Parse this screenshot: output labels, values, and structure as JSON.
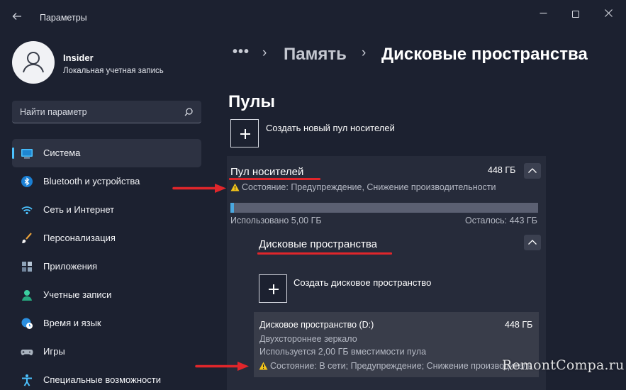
{
  "window": {
    "title": "Параметры"
  },
  "user": {
    "name": "Insider",
    "account_type": "Локальная учетная запись"
  },
  "search": {
    "placeholder": "Найти параметр"
  },
  "sidebar": {
    "items": [
      {
        "label": "Система",
        "icon": "system-icon",
        "active": true
      },
      {
        "label": "Bluetooth и устройства",
        "icon": "bluetooth-icon"
      },
      {
        "label": "Сеть и Интернет",
        "icon": "wifi-icon"
      },
      {
        "label": "Персонализация",
        "icon": "brush-icon"
      },
      {
        "label": "Приложения",
        "icon": "apps-icon"
      },
      {
        "label": "Учетные записи",
        "icon": "account-icon"
      },
      {
        "label": "Время и язык",
        "icon": "globe-clock-icon"
      },
      {
        "label": "Игры",
        "icon": "gamepad-icon"
      },
      {
        "label": "Специальные возможности",
        "icon": "accessibility-icon"
      }
    ]
  },
  "breadcrumb": {
    "more": "•••",
    "parent": "Память",
    "current": "Дисковые пространства"
  },
  "pools": {
    "section_title": "Пулы",
    "create_label": "Создать новый пул носителей",
    "pool": {
      "name": "Пул носителей",
      "size": "448 ГБ",
      "status": "Состояние: Предупреждение, Снижение производительности",
      "used_fraction": 0.011,
      "used_label": "Использовано 5,00 ГБ",
      "free_label": "Осталось: 443 ГБ"
    }
  },
  "spaces": {
    "title": "Дисковые пространства",
    "create_label": "Создать дисковое пространство",
    "space": {
      "name": "Дисковое пространство (D:)",
      "size": "448 ГБ",
      "type": "Двухстороннее зеркало",
      "usage": "Используется 2,00 ГБ вместимости пула",
      "status": "Состояние: В сети; Предупреждение; Снижение производительности"
    }
  },
  "watermark": "RemontCompa.ru",
  "colors": {
    "accent": "#4cc2ff",
    "annotation_red": "#e0262b",
    "warning_yellow": "#f5c518",
    "background": "#1c2130"
  }
}
